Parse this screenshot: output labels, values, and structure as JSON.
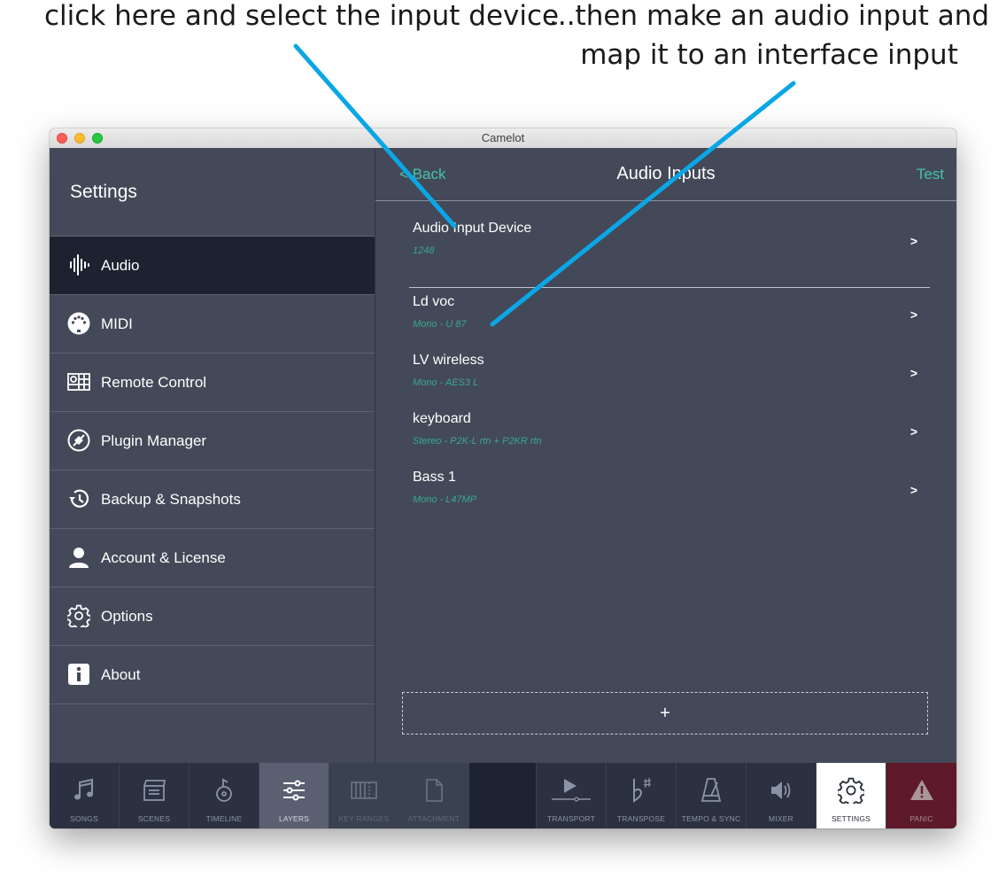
{
  "annotations": {
    "left": "click here and select the input device",
    "right_line1": "...then make an audio input and",
    "right_line2": "map it to an interface input",
    "arrow_color": "#0aa6e6"
  },
  "window": {
    "title": "Camelot"
  },
  "sidebar": {
    "title": "Settings",
    "items": [
      {
        "label": "Audio",
        "icon": "waveform-icon",
        "active": true
      },
      {
        "label": "MIDI",
        "icon": "midi-connector-icon"
      },
      {
        "label": "Remote Control",
        "icon": "remote-grid-icon"
      },
      {
        "label": "Plugin Manager",
        "icon": "plugin-icon"
      },
      {
        "label": "Backup & Snapshots",
        "icon": "history-icon"
      },
      {
        "label": "Account & License",
        "icon": "user-icon"
      },
      {
        "label": "Options",
        "icon": "gear-icon"
      },
      {
        "label": "About",
        "icon": "info-icon"
      }
    ]
  },
  "main": {
    "back_label": "< Back",
    "title": "Audio Inputs",
    "test_label": "Test",
    "device": {
      "title": "Audio Input Device",
      "value": "1248",
      "chevron": ">"
    },
    "inputs": [
      {
        "name": "Ld voc",
        "detail": "Mono - U 87",
        "chevron": ">"
      },
      {
        "name": "LV wireless",
        "detail": "Mono - AES3 L",
        "chevron": ">"
      },
      {
        "name": "keyboard",
        "detail": "Stereo - P2K-L rtn + P2KR rtn",
        "chevron": ">"
      },
      {
        "name": "Bass 1",
        "detail": "Mono - L47MP",
        "chevron": ">"
      }
    ],
    "add_label": "+"
  },
  "toolbar": {
    "items": [
      {
        "label": "SONGS",
        "icon": "music-note-icon"
      },
      {
        "label": "SCENES",
        "icon": "clapperboard-icon"
      },
      {
        "label": "TIMELINE",
        "icon": "timeline-icon"
      },
      {
        "label": "LAYERS",
        "icon": "sliders-icon"
      },
      {
        "label": "KEY RANGES",
        "icon": "piano-keys-icon"
      },
      {
        "label": "ATTACHMENT",
        "icon": "document-icon"
      },
      {
        "label": "TRANSPORT",
        "icon": "play-icon"
      },
      {
        "label": "TRANSPOSE",
        "icon": "flat-sharp-icon"
      },
      {
        "label": "TEMPO & SYNC",
        "icon": "metronome-icon"
      },
      {
        "label": "MIXER",
        "icon": "speaker-icon"
      },
      {
        "label": "SETTINGS",
        "icon": "gear-icon"
      },
      {
        "label": "PANIC",
        "icon": "warning-icon"
      }
    ],
    "colors": {
      "bar": "#1d2331",
      "layers_bg": "#5a6072",
      "settings_bg": "#ffffff",
      "panic_bg": "#5e1a2a",
      "dim_bg": "#3a4150"
    }
  }
}
